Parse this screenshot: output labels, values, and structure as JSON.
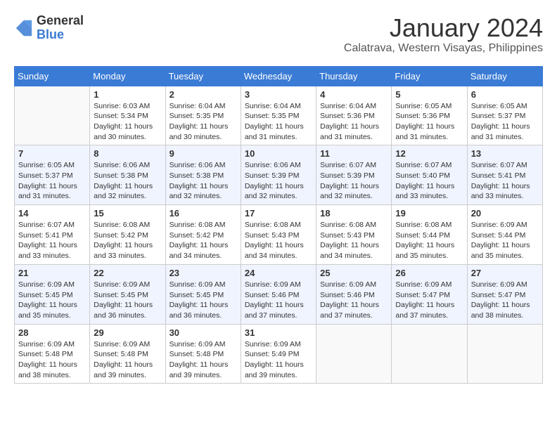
{
  "header": {
    "logo_general": "General",
    "logo_blue": "Blue",
    "month_title": "January 2024",
    "location": "Calatrava, Western Visayas, Philippines"
  },
  "calendar": {
    "headers": [
      "Sunday",
      "Monday",
      "Tuesday",
      "Wednesday",
      "Thursday",
      "Friday",
      "Saturday"
    ],
    "weeks": [
      [
        {
          "day": "",
          "info": ""
        },
        {
          "day": "1",
          "info": "Sunrise: 6:03 AM\nSunset: 5:34 PM\nDaylight: 11 hours\nand 30 minutes."
        },
        {
          "day": "2",
          "info": "Sunrise: 6:04 AM\nSunset: 5:35 PM\nDaylight: 11 hours\nand 30 minutes."
        },
        {
          "day": "3",
          "info": "Sunrise: 6:04 AM\nSunset: 5:35 PM\nDaylight: 11 hours\nand 31 minutes."
        },
        {
          "day": "4",
          "info": "Sunrise: 6:04 AM\nSunset: 5:36 PM\nDaylight: 11 hours\nand 31 minutes."
        },
        {
          "day": "5",
          "info": "Sunrise: 6:05 AM\nSunset: 5:36 PM\nDaylight: 11 hours\nand 31 minutes."
        },
        {
          "day": "6",
          "info": "Sunrise: 6:05 AM\nSunset: 5:37 PM\nDaylight: 11 hours\nand 31 minutes."
        }
      ],
      [
        {
          "day": "7",
          "info": "Sunrise: 6:05 AM\nSunset: 5:37 PM\nDaylight: 11 hours\nand 31 minutes."
        },
        {
          "day": "8",
          "info": "Sunrise: 6:06 AM\nSunset: 5:38 PM\nDaylight: 11 hours\nand 32 minutes."
        },
        {
          "day": "9",
          "info": "Sunrise: 6:06 AM\nSunset: 5:38 PM\nDaylight: 11 hours\nand 32 minutes."
        },
        {
          "day": "10",
          "info": "Sunrise: 6:06 AM\nSunset: 5:39 PM\nDaylight: 11 hours\nand 32 minutes."
        },
        {
          "day": "11",
          "info": "Sunrise: 6:07 AM\nSunset: 5:39 PM\nDaylight: 11 hours\nand 32 minutes."
        },
        {
          "day": "12",
          "info": "Sunrise: 6:07 AM\nSunset: 5:40 PM\nDaylight: 11 hours\nand 33 minutes."
        },
        {
          "day": "13",
          "info": "Sunrise: 6:07 AM\nSunset: 5:41 PM\nDaylight: 11 hours\nand 33 minutes."
        }
      ],
      [
        {
          "day": "14",
          "info": "Sunrise: 6:07 AM\nSunset: 5:41 PM\nDaylight: 11 hours\nand 33 minutes."
        },
        {
          "day": "15",
          "info": "Sunrise: 6:08 AM\nSunset: 5:42 PM\nDaylight: 11 hours\nand 33 minutes."
        },
        {
          "day": "16",
          "info": "Sunrise: 6:08 AM\nSunset: 5:42 PM\nDaylight: 11 hours\nand 34 minutes."
        },
        {
          "day": "17",
          "info": "Sunrise: 6:08 AM\nSunset: 5:43 PM\nDaylight: 11 hours\nand 34 minutes."
        },
        {
          "day": "18",
          "info": "Sunrise: 6:08 AM\nSunset: 5:43 PM\nDaylight: 11 hours\nand 34 minutes."
        },
        {
          "day": "19",
          "info": "Sunrise: 6:08 AM\nSunset: 5:44 PM\nDaylight: 11 hours\nand 35 minutes."
        },
        {
          "day": "20",
          "info": "Sunrise: 6:09 AM\nSunset: 5:44 PM\nDaylight: 11 hours\nand 35 minutes."
        }
      ],
      [
        {
          "day": "21",
          "info": "Sunrise: 6:09 AM\nSunset: 5:45 PM\nDaylight: 11 hours\nand 35 minutes."
        },
        {
          "day": "22",
          "info": "Sunrise: 6:09 AM\nSunset: 5:45 PM\nDaylight: 11 hours\nand 36 minutes."
        },
        {
          "day": "23",
          "info": "Sunrise: 6:09 AM\nSunset: 5:45 PM\nDaylight: 11 hours\nand 36 minutes."
        },
        {
          "day": "24",
          "info": "Sunrise: 6:09 AM\nSunset: 5:46 PM\nDaylight: 11 hours\nand 37 minutes."
        },
        {
          "day": "25",
          "info": "Sunrise: 6:09 AM\nSunset: 5:46 PM\nDaylight: 11 hours\nand 37 minutes."
        },
        {
          "day": "26",
          "info": "Sunrise: 6:09 AM\nSunset: 5:47 PM\nDaylight: 11 hours\nand 37 minutes."
        },
        {
          "day": "27",
          "info": "Sunrise: 6:09 AM\nSunset: 5:47 PM\nDaylight: 11 hours\nand 38 minutes."
        }
      ],
      [
        {
          "day": "28",
          "info": "Sunrise: 6:09 AM\nSunset: 5:48 PM\nDaylight: 11 hours\nand 38 minutes."
        },
        {
          "day": "29",
          "info": "Sunrise: 6:09 AM\nSunset: 5:48 PM\nDaylight: 11 hours\nand 39 minutes."
        },
        {
          "day": "30",
          "info": "Sunrise: 6:09 AM\nSunset: 5:48 PM\nDaylight: 11 hours\nand 39 minutes."
        },
        {
          "day": "31",
          "info": "Sunrise: 6:09 AM\nSunset: 5:49 PM\nDaylight: 11 hours\nand 39 minutes."
        },
        {
          "day": "",
          "info": ""
        },
        {
          "day": "",
          "info": ""
        },
        {
          "day": "",
          "info": ""
        }
      ]
    ]
  }
}
